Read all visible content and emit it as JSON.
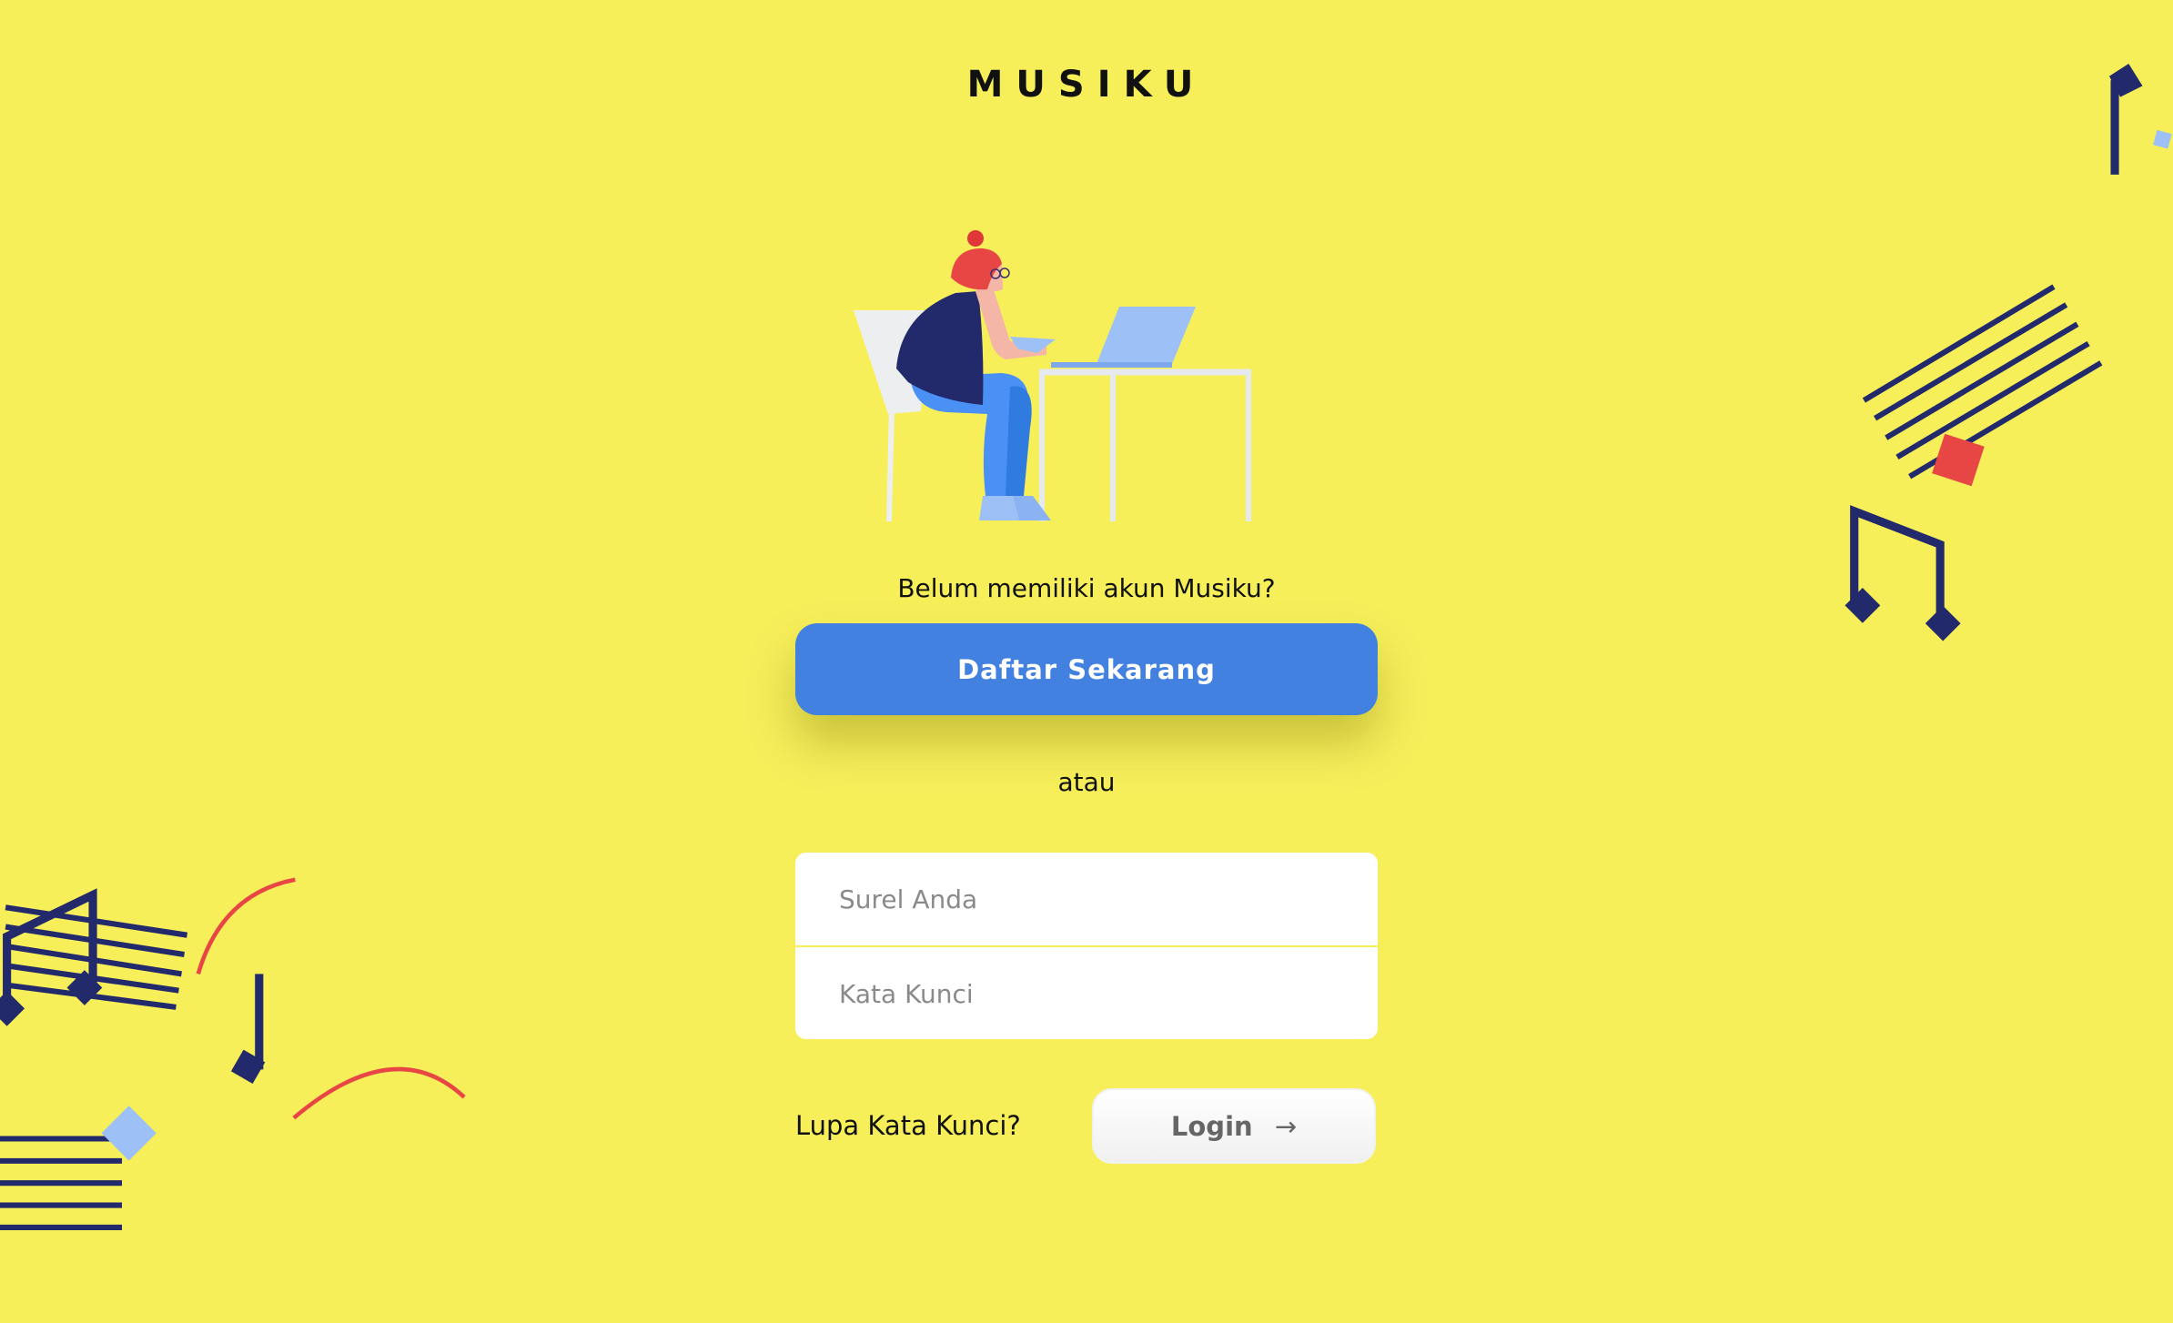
{
  "app": {
    "title": "MUSIKU"
  },
  "signup": {
    "prompt": "Belum memiliki akun Musiku?",
    "button_label": "Daftar Sekarang"
  },
  "divider_text": "atau",
  "login_form": {
    "email_placeholder": "Surel Anda",
    "email_value": "",
    "password_placeholder": "Kata Kunci",
    "password_value": "",
    "forgot_label": "Lupa Kata Kunci?",
    "login_label": "Login",
    "login_icon": "arrow-right-icon"
  },
  "colors": {
    "background": "#f6ef5a",
    "primary": "#4281e0",
    "navy": "#232a6b",
    "accent_red": "#e84545",
    "light_blue": "#9dc0f7"
  }
}
